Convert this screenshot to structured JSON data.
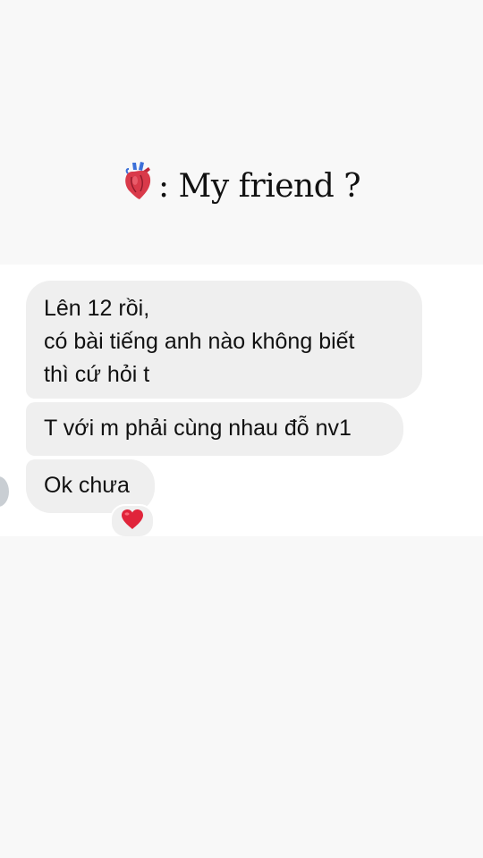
{
  "header": {
    "title": ": My friend ?"
  },
  "messages": [
    {
      "text": "Lên 12 rồi,\ncó bài tiếng anh nào không biết\nthì cứ hỏi t"
    },
    {
      "text": "T với m phải cùng nhau đỗ nv1"
    },
    {
      "text": "Ok chưa"
    }
  ],
  "reaction": {
    "icon": "red-heart-icon"
  },
  "colors": {
    "background": "#f8f8f8",
    "chat_background": "#ffffff",
    "bubble": "#efefef",
    "heart": "#e0243a"
  }
}
